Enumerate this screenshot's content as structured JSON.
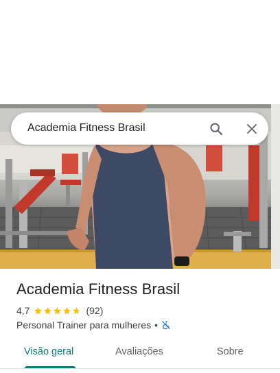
{
  "search": {
    "query": "Academia Fitness Brasil"
  },
  "place": {
    "name": "Academia Fitness Brasil",
    "rating": "4,7",
    "stars_filled": 4.7,
    "review_count": "(92)",
    "category": "Personal Trainer para mulheres",
    "separator": "•"
  },
  "tabs": {
    "items": [
      {
        "label": "Visão geral",
        "active": true
      },
      {
        "label": "Avaliações",
        "active": false
      },
      {
        "label": "Sobre",
        "active": false
      }
    ]
  },
  "colors": {
    "accent": "#0b7e73",
    "star": "#fbbc04",
    "accessibility_icon": "#1a73e8"
  },
  "icons": {
    "search": "search-icon",
    "close": "close-icon",
    "accessibility": "wheelchair-not-accessible-icon"
  }
}
